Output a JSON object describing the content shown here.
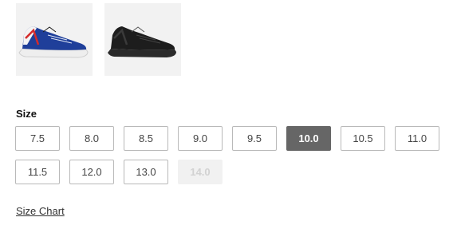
{
  "product": {
    "colorways": [
      {
        "icon": "sneaker-blue-white-red-icon",
        "colors": {
          "upper": "#1f3f9a",
          "sole": "#eeeeee",
          "accent": "#d42b2b"
        }
      },
      {
        "icon": "sneaker-black-icon",
        "colors": {
          "upper": "#1d1d1d",
          "sole": "#2a2a2a",
          "accent": "#555555"
        }
      }
    ]
  },
  "size_picker": {
    "label": "Size",
    "selected": "10.0",
    "rows": [
      [
        {
          "label": "7.5",
          "state": "available"
        },
        {
          "label": "8.0",
          "state": "available"
        },
        {
          "label": "8.5",
          "state": "available"
        },
        {
          "label": "9.0",
          "state": "available"
        },
        {
          "label": "9.5",
          "state": "available"
        },
        {
          "label": "10.0",
          "state": "selected"
        },
        {
          "label": "10.5",
          "state": "available"
        },
        {
          "label": "11.0",
          "state": "available"
        }
      ],
      [
        {
          "label": "11.5",
          "state": "available"
        },
        {
          "label": "12.0",
          "state": "available"
        },
        {
          "label": "13.0",
          "state": "available"
        },
        {
          "label": "14.0",
          "state": "disabled"
        }
      ]
    ]
  },
  "links": {
    "size_chart": "Size Chart"
  },
  "colors": {
    "selected_bg": "#666666",
    "disabled_bg": "#f1f1f1",
    "border": "#b9b9b9"
  }
}
